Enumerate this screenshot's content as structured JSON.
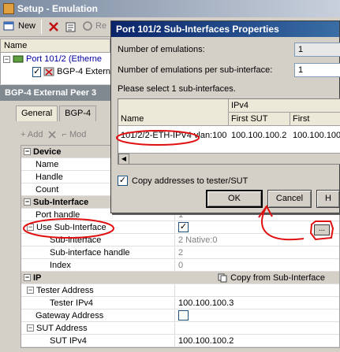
{
  "window": {
    "title": "Setup - Emulation"
  },
  "toolbar": {
    "new_label": "New",
    "re_label": "Re"
  },
  "tree": {
    "header": "Name",
    "rows": [
      {
        "label": "Port 101/2 (Etherne"
      },
      {
        "label": "BGP-4 Extern"
      }
    ]
  },
  "panel": {
    "title": "BGP-4 External Peer 3",
    "tabs": [
      {
        "label": "General"
      },
      {
        "label": "BGP-4"
      }
    ],
    "add_label": "Add",
    "mod_label": "Mod"
  },
  "grid": {
    "device": {
      "category": "Device",
      "name": "Name",
      "handle": "Handle",
      "count": "Count"
    },
    "subif": {
      "category": "Sub-Interface",
      "port_handle": "Port handle",
      "port_handle_val": "1",
      "use_subif": "Use Sub-Interface",
      "use_subif_checked": true,
      "subif_label": "Sub-interface",
      "subif_val": "2 Native:0",
      "subif_handle": "Sub-interface handle",
      "subif_handle_val": "2",
      "index": "Index",
      "index_val": "0"
    },
    "ip": {
      "category": "IP",
      "copy_label": "Copy from Sub-Interface",
      "tester_address": "Tester Address",
      "tester_ipv4": "Tester IPv4",
      "tester_ipv4_val": "100.100.100.3",
      "gateway_address": "Gateway Address",
      "gateway_checked": false,
      "sut_address": "SUT Address",
      "sut_ipv4": "SUT IPv4",
      "sut_ipv4_val": "100.100.100.2"
    },
    "ellipsis": "..."
  },
  "dialog": {
    "title": "Port 101/2 Sub-Interfaces Properties",
    "num_emulations_label": "Number of emulations:",
    "num_emulations_val": "1",
    "per_subif_label": "Number of emulations per sub-interface:",
    "per_subif_val": "1",
    "select_label": "Please select 1 sub-interfaces.",
    "table": {
      "group_header": "IPv4",
      "col_name": "Name",
      "col_first_sut": "First SUT",
      "col_first": "First",
      "row": {
        "name": "101/2/2-ETH-IPV4 vlan:100",
        "first_sut": "100.100.100.2",
        "first": "100.100.100."
      }
    },
    "copy_addresses_label": "Copy addresses to tester/SUT",
    "copy_addresses_checked": true,
    "ok_label": "OK",
    "cancel_label": "Cancel",
    "help_label": "H"
  },
  "annotation_color": "#e01010"
}
